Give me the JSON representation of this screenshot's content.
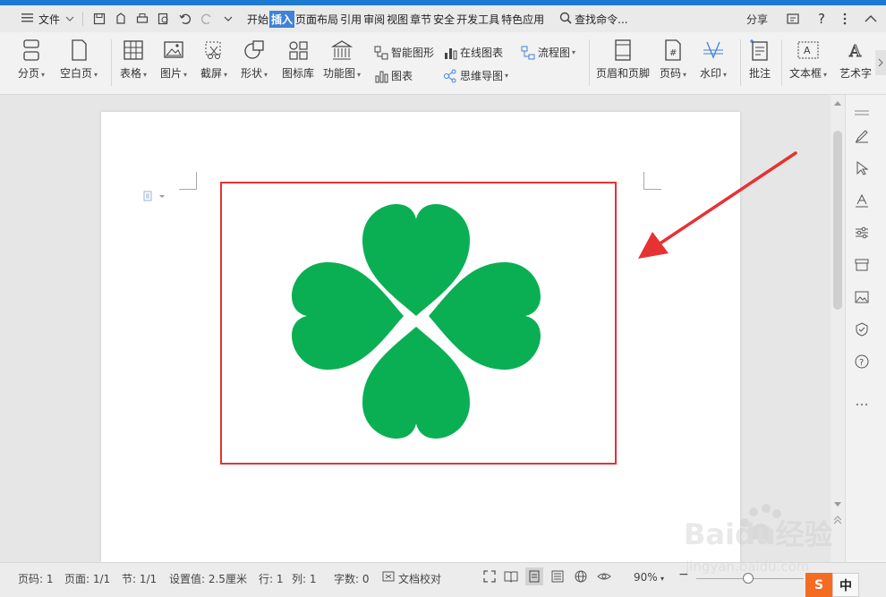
{
  "menubar": {
    "menu_label": "文件",
    "tabs": [
      "开始",
      "插入",
      "页面布局",
      "引用",
      "审阅",
      "视图",
      "章节",
      "安全",
      "开发工具",
      "特色应用"
    ],
    "active_tab": "插入",
    "search_label": "查找命令...",
    "share_label": "分享",
    "help_label": "?"
  },
  "ribbon": {
    "page_break": "分页",
    "blank_page": "空白页",
    "table": "表格",
    "picture": "图片",
    "screenshot": "截屏",
    "shape": "形状",
    "icon_library": "图标库",
    "function_chart": "功能图",
    "smart_art": "智能图形",
    "chart": "图表",
    "online_chart": "在线图表",
    "mind_map": "思维导图",
    "flowchart": "流程图",
    "header_footer": "页眉和页脚",
    "page_number": "页码",
    "watermark": "水印",
    "comment": "批注",
    "text_box": "文本框",
    "word_art": "艺术字"
  },
  "status": {
    "page_num": "页码: 1",
    "pages": "页面: 1/1",
    "section": "节: 1/1",
    "setting": "设置值: 2.5厘米",
    "row": "行: 1",
    "col": "列: 1",
    "word_count": "字数: 0",
    "proofread": "文档校对",
    "zoom": "90%"
  },
  "watermark_text": {
    "brand": "Baidu经验",
    "url": "jingyan.baidu.com"
  },
  "ime": {
    "logo": "S",
    "lang": "中"
  },
  "colors": {
    "clover": "#0aaf54",
    "highlight": "#e63232",
    "accent": "#3f82d7"
  }
}
